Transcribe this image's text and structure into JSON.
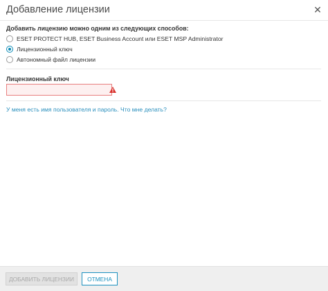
{
  "dialog": {
    "title": "Добавление лицензии",
    "close_icon": "close-icon"
  },
  "methods": {
    "label": "Добавить лицензию можно одним из следующих способов:",
    "options": [
      {
        "label": "ESET PROTECT HUB, ESET Business Account или ESET MSP Administrator",
        "checked": false
      },
      {
        "label": "Лицензионный ключ",
        "checked": true
      },
      {
        "label": "Автономный файл лицензии",
        "checked": false
      }
    ]
  },
  "license_key": {
    "label": "Лицензионный ключ",
    "value": "",
    "status_icon": "warning-icon"
  },
  "help_link": "У меня есть имя пользователя и пароль. Что мне делать?",
  "footer": {
    "add_label": "ДОБАВИТЬ ЛИЦЕНЗИИ",
    "cancel_label": "ОТМЕНА"
  },
  "colors": {
    "accent": "#0b8ab5",
    "error_border": "#e87f7f",
    "error_bg": "#fdf0f0",
    "warning": "#d9312c"
  }
}
